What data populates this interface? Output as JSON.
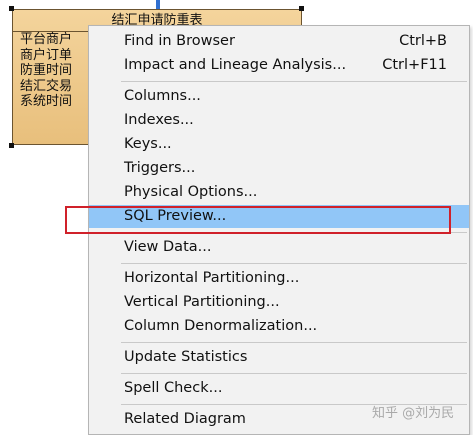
{
  "entity": {
    "title": "结汇申请防重表",
    "columns": [
      "平台商户",
      "商户订单",
      "防重时间",
      "结汇交易",
      "系统时间"
    ]
  },
  "menu": {
    "groups": [
      [
        {
          "label": "Find in Browser",
          "shortcut": "Ctrl+B"
        },
        {
          "label": "Impact and Lineage Analysis...",
          "shortcut": "Ctrl+F11"
        }
      ],
      [
        {
          "label": "Columns...",
          "shortcut": ""
        },
        {
          "label": "Indexes...",
          "shortcut": ""
        },
        {
          "label": "Keys...",
          "shortcut": ""
        },
        {
          "label": "Triggers...",
          "shortcut": ""
        },
        {
          "label": "Physical Options...",
          "shortcut": ""
        },
        {
          "label": "SQL Preview...",
          "shortcut": "",
          "highlighted": true
        }
      ],
      [
        {
          "label": "View Data...",
          "shortcut": ""
        }
      ],
      [
        {
          "label": "Horizontal Partitioning...",
          "shortcut": ""
        },
        {
          "label": "Vertical Partitioning...",
          "shortcut": ""
        },
        {
          "label": "Column Denormalization...",
          "shortcut": ""
        }
      ],
      [
        {
          "label": "Update Statistics",
          "shortcut": ""
        }
      ],
      [
        {
          "label": "Spell Check...",
          "shortcut": ""
        }
      ],
      [
        {
          "label": "Related Diagram",
          "shortcut": ""
        }
      ]
    ]
  },
  "watermark": "知乎 @刘为民",
  "colors": {
    "highlight": "#91c6f7",
    "annotation_box": "#d0212a",
    "entity_fill": "#efcb8e"
  }
}
